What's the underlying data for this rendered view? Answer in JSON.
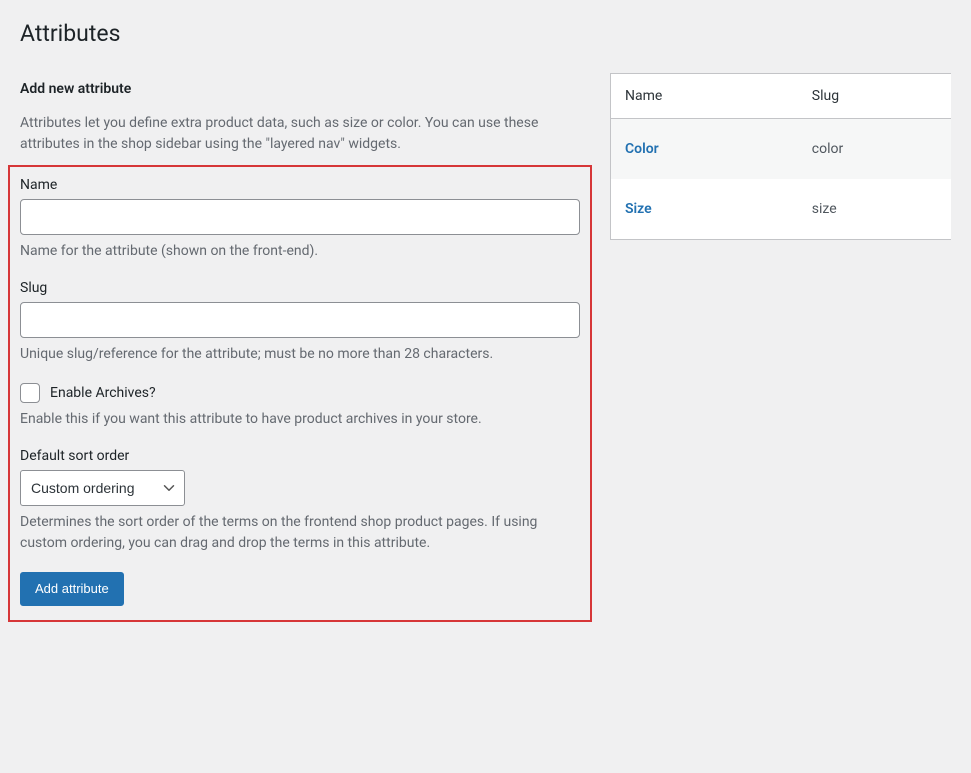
{
  "page": {
    "title": "Attributes"
  },
  "form": {
    "heading": "Add new attribute",
    "intro": "Attributes let you define extra product data, such as size or color. You can use these attributes in the shop sidebar using the \"layered nav\" widgets.",
    "name": {
      "label": "Name",
      "value": "",
      "help": "Name for the attribute (shown on the front-end)."
    },
    "slug": {
      "label": "Slug",
      "value": "",
      "help": "Unique slug/reference for the attribute; must be no more than 28 characters."
    },
    "archives": {
      "label": "Enable Archives?",
      "help": "Enable this if you want this attribute to have product archives in your store."
    },
    "sort": {
      "label": "Default sort order",
      "selected": "Custom ordering",
      "help": "Determines the sort order of the terms on the frontend shop product pages. If using custom ordering, you can drag and drop the terms in this attribute."
    },
    "submit": "Add attribute"
  },
  "table": {
    "headers": {
      "name": "Name",
      "slug": "Slug"
    },
    "rows": [
      {
        "name": "Color",
        "slug": "color"
      },
      {
        "name": "Size",
        "slug": "size"
      }
    ]
  }
}
